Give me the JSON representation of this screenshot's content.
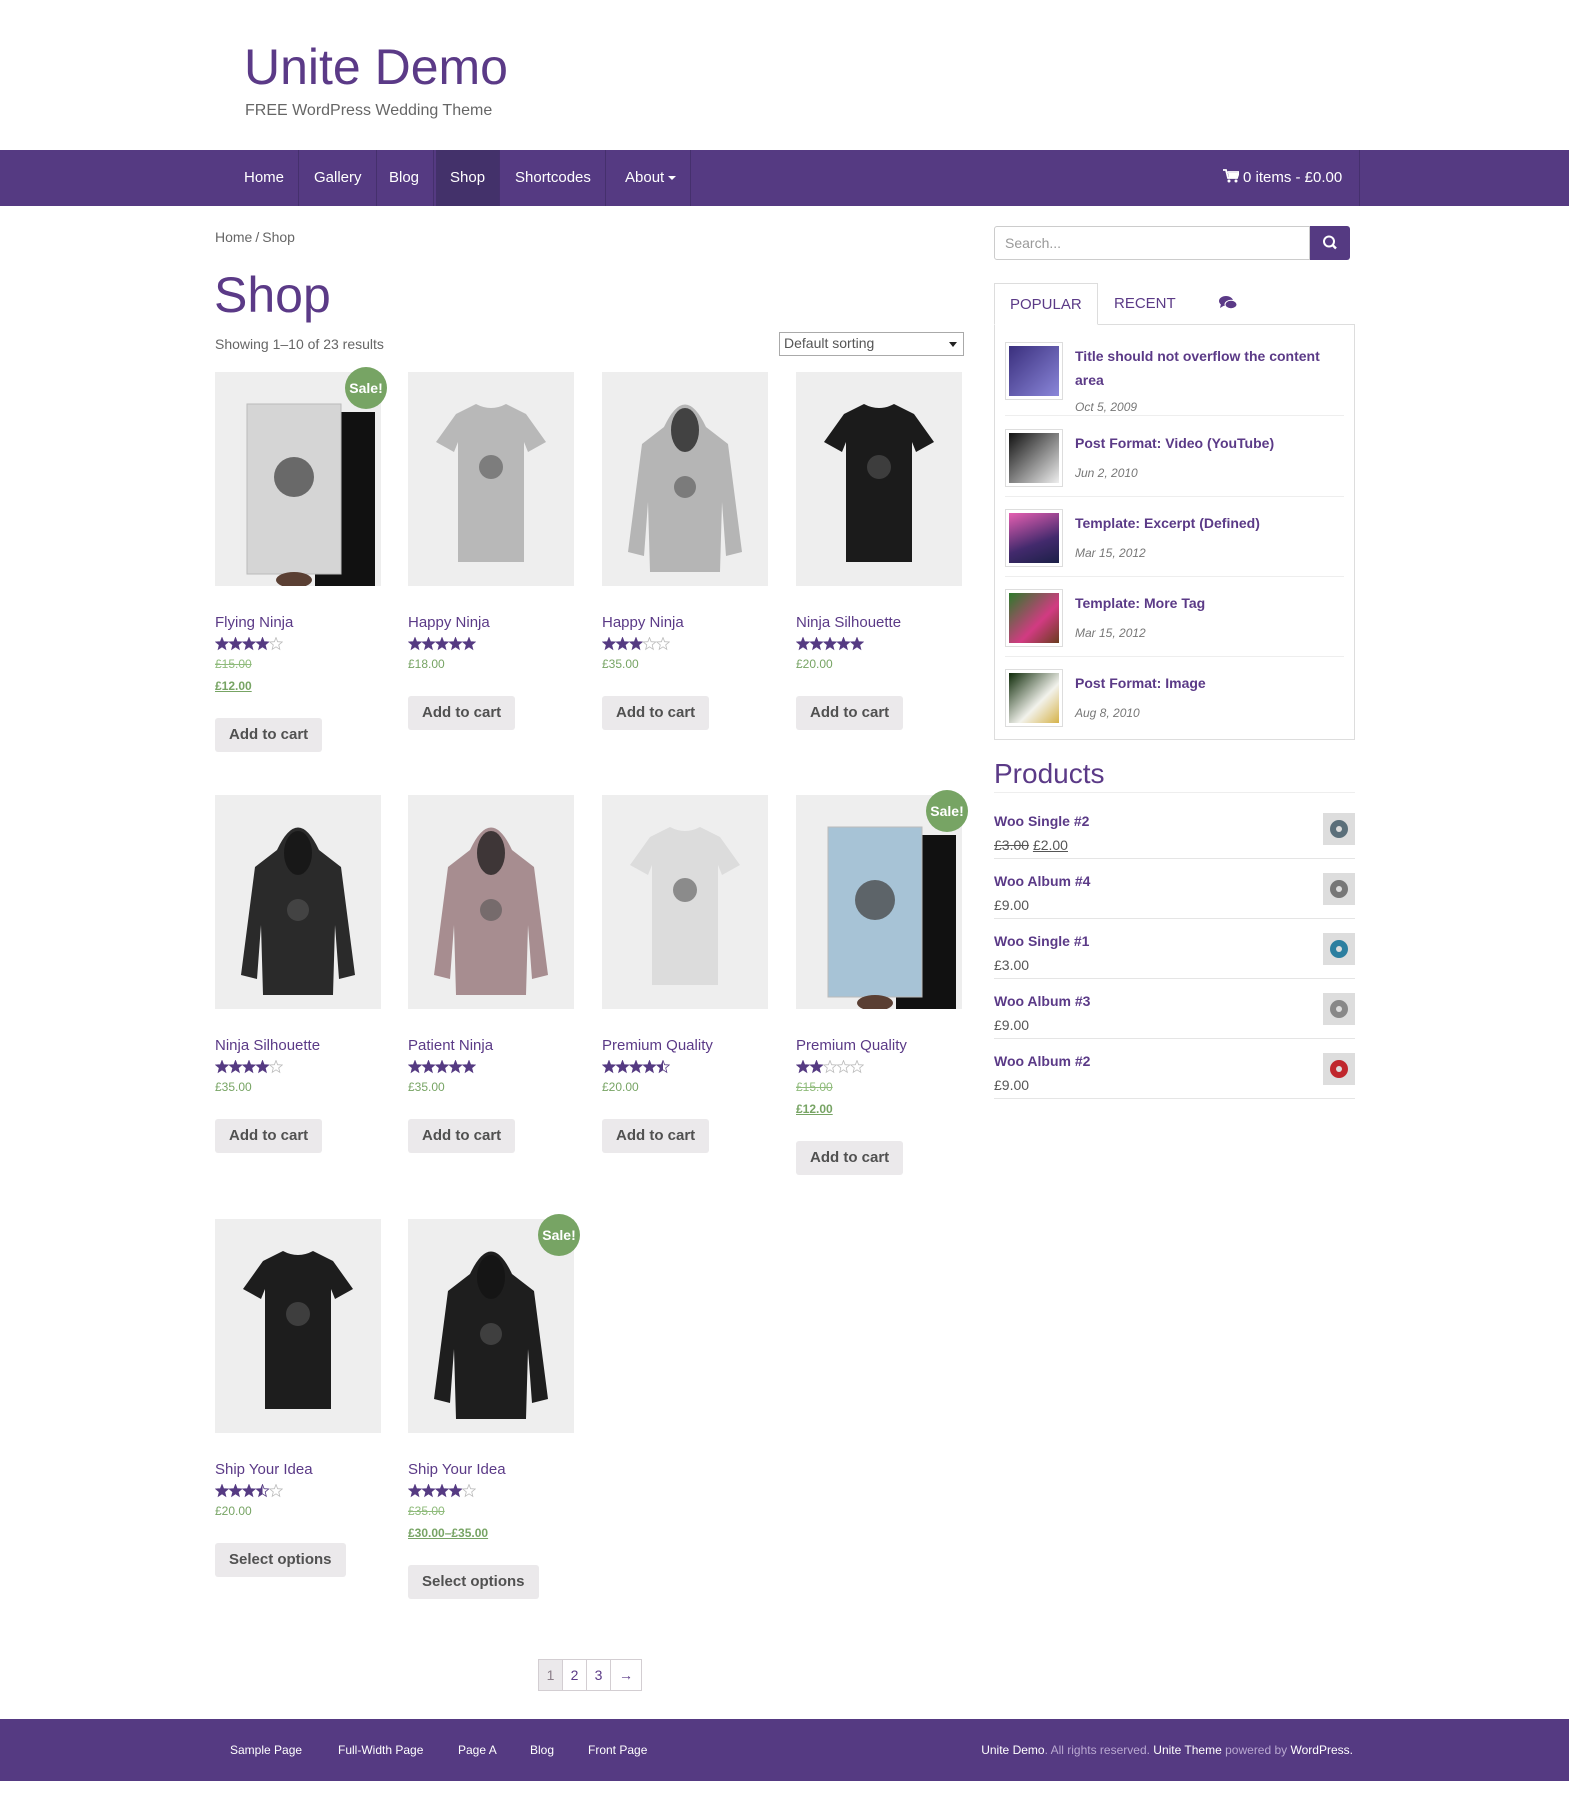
{
  "site": {
    "title": "Unite Demo",
    "tagline": "FREE WordPress Wedding Theme"
  },
  "nav": {
    "items": [
      {
        "label": "Home"
      },
      {
        "label": "Gallery"
      },
      {
        "label": "Blog"
      },
      {
        "label": "Shop"
      },
      {
        "label": "Shortcodes"
      },
      {
        "label": "About"
      }
    ],
    "active": "Shop",
    "cart_label": "0 items - £0.00"
  },
  "breadcrumb": {
    "home": "Home",
    "sep": "/",
    "current": "Shop"
  },
  "page_title": "Shop",
  "result_count": "Showing 1–10 of 23 results",
  "ordering": {
    "selected": "Default sorting"
  },
  "products": [
    {
      "name": "Flying Ninja",
      "rating": 4,
      "old_price": "£15.00",
      "price": "£12.00",
      "sale": true,
      "button": "Add to cart"
    },
    {
      "name": "Happy Ninja",
      "rating": 5,
      "price": "£18.00",
      "sale": false,
      "button": "Add to cart"
    },
    {
      "name": "Happy Ninja",
      "rating": 3,
      "price": "£35.00",
      "sale": false,
      "button": "Add to cart"
    },
    {
      "name": "Ninja Silhouette",
      "rating": 5,
      "price": "£20.00",
      "sale": false,
      "button": "Add to cart"
    },
    {
      "name": "Ninja Silhouette",
      "rating": 4,
      "price": "£35.00",
      "sale": false,
      "button": "Add to cart"
    },
    {
      "name": "Patient Ninja",
      "rating": 5,
      "price": "£35.00",
      "sale": false,
      "button": "Add to cart"
    },
    {
      "name": "Premium Quality",
      "rating": 4.5,
      "price": "£20.00",
      "sale": false,
      "button": "Add to cart"
    },
    {
      "name": "Premium Quality",
      "rating": 2,
      "old_price": "£15.00",
      "price": "£12.00",
      "sale": true,
      "button": "Add to cart"
    },
    {
      "name": "Ship Your Idea",
      "rating": 3.5,
      "price": "£20.00",
      "sale": false,
      "button": "Select options"
    },
    {
      "name": "Ship Your Idea",
      "rating": 4,
      "old_price": "£35.00",
      "price": "£30.00–£35.00",
      "sale": true,
      "button": "Select options"
    }
  ],
  "sale_label": "Sale!",
  "pagination": {
    "pages": [
      "1",
      "2",
      "3"
    ],
    "current": "1",
    "next": "→"
  },
  "sidebar": {
    "search_placeholder": "Search...",
    "tabs": {
      "popular": "POPULAR",
      "recent": "RECENT",
      "comments_icon": "comments-icon"
    },
    "popular_posts": [
      {
        "title": "Title should not overflow the content area",
        "date": "Oct 5, 2009"
      },
      {
        "title": "Post Format: Video (YouTube)",
        "date": "Jun 2, 2010"
      },
      {
        "title": "Template: Excerpt (Defined)",
        "date": "Mar 15, 2012"
      },
      {
        "title": "Template: More Tag",
        "date": "Mar 15, 2012"
      },
      {
        "title": "Post Format: Image",
        "date": "Aug 8, 2010"
      }
    ],
    "products_widget": {
      "title": "Products",
      "items": [
        {
          "name": "Woo Single #2",
          "old_price": "£3.00",
          "price": "£2.00"
        },
        {
          "name": "Woo Album #4",
          "price": "£9.00"
        },
        {
          "name": "Woo Single #1",
          "price": "£3.00"
        },
        {
          "name": "Woo Album #3",
          "price": "£9.00"
        },
        {
          "name": "Woo Album #2",
          "price": "£9.00"
        }
      ]
    }
  },
  "footer": {
    "links": [
      "Sample Page",
      "Full-Width Page",
      "Page A",
      "Blog",
      "Front Page"
    ],
    "site_name": "Unite Demo",
    "rights": ". All rights reserved.",
    "theme": "Unite Theme",
    "powered_by": "powered by",
    "wordpress": "WordPress"
  },
  "colors": {
    "brand": "#553a82",
    "link": "#5b3a87",
    "sale_green": "#77a464"
  }
}
